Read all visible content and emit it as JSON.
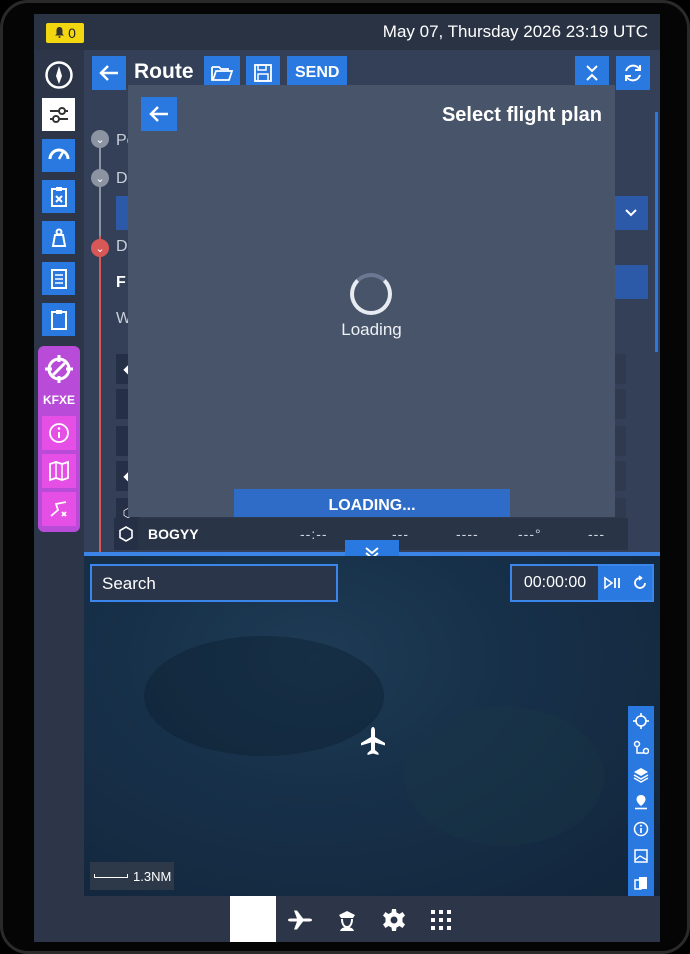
{
  "status_bar": {
    "alert_count": "0",
    "datetime": "May 07, Thursday 2026 23:19 UTC"
  },
  "sidebar": {
    "items": [
      {
        "icon": "compass-icon"
      },
      {
        "icon": "sliders-icon"
      },
      {
        "icon": "gauge-icon"
      },
      {
        "icon": "clipboard-x-icon"
      },
      {
        "icon": "weight-icon"
      },
      {
        "icon": "document-icon"
      },
      {
        "icon": "clipboard-icon"
      }
    ],
    "airport_group": {
      "code": "KFXE",
      "items": [
        {
          "icon": "info-icon"
        },
        {
          "icon": "map-icon"
        },
        {
          "icon": "route-icon"
        }
      ]
    }
  },
  "route_panel": {
    "title": "Route",
    "send_label": "SEND",
    "partial_labels": [
      "Pe",
      "D",
      "D",
      "F",
      "W"
    ],
    "waypoint_row": {
      "name": "BOGYY",
      "time": "--:--",
      "col2": "---",
      "col3": "----",
      "heading": "---°",
      "col5": "---"
    }
  },
  "modal": {
    "title": "Select flight plan",
    "loading_text": "Loading",
    "loading_button": "LOADING..."
  },
  "map": {
    "search_placeholder": "Search",
    "timer": "00:00:00",
    "scale_label": "1.3NM"
  },
  "colors": {
    "accent": "#2979e0",
    "airport_group": "#e64fe6",
    "alert": "#f2d60f",
    "danger": "#d85757"
  }
}
